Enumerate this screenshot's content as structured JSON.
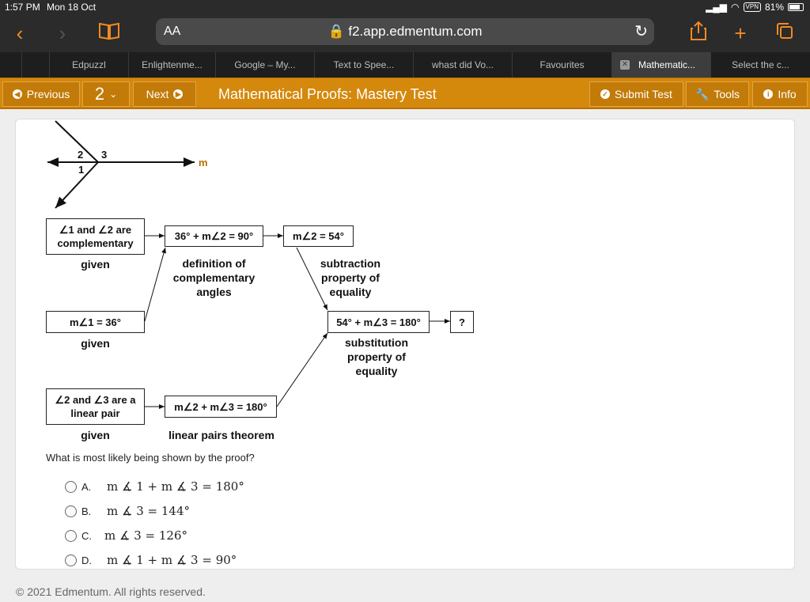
{
  "status": {
    "time": "1:57 PM",
    "date": "Mon 18 Oct",
    "vpn": "VPN",
    "battery": "81%"
  },
  "browser": {
    "aa": "AA",
    "url": "f2.app.edmentum.com"
  },
  "tabs": [
    "",
    "",
    "Edpuzzl",
    "Enlightenme...",
    "Google – My...",
    "Text to Spee...",
    "whast did Vo...",
    "Favourites",
    "Mathematic...",
    "Select the c..."
  ],
  "header": {
    "previous": "Previous",
    "question_number": "2",
    "next": "Next",
    "title": "Mathematical Proofs: Mastery Test",
    "submit": "Submit Test",
    "tools": "Tools",
    "info": "Info"
  },
  "figure": {
    "angle2": "2",
    "angle3": "3",
    "angle1": "1",
    "line_m": "m"
  },
  "proof": {
    "b1": "∠1 and ∠2 are complementary",
    "l1": "given",
    "b2": "36° + m∠2 = 90°",
    "l2": "definition of complementary angles",
    "b3": "m∠2 = 54°",
    "l3": "subtraction property of equality",
    "b4": "m∠1 = 36°",
    "l4": "given",
    "b5": "54° + m∠3 = 180°",
    "l5": "substitution property of equality",
    "b6": "?",
    "b7": "∠2 and ∠3 are a linear pair",
    "l7": "given",
    "b8": "m∠2 + m∠3 = 180°",
    "l8": "linear pairs theorem"
  },
  "question": "What is most likely being shown by the proof?",
  "choices": [
    {
      "letter": "A.",
      "text": "m ∡ 1 + m ∡ 3 = 180°"
    },
    {
      "letter": "B.",
      "text": "m ∡ 3 = 144°"
    },
    {
      "letter": "C.",
      "text": "m ∡ 3 = 126°"
    },
    {
      "letter": "D.",
      "text": "m ∡ 1 + m ∡ 3 = 90°"
    }
  ],
  "footer": "© 2021 Edmentum. All rights reserved.",
  "colors": {
    "accent": "#d4880c",
    "browser_icon": "#f08a24",
    "chrome": "#2b2b2b"
  }
}
